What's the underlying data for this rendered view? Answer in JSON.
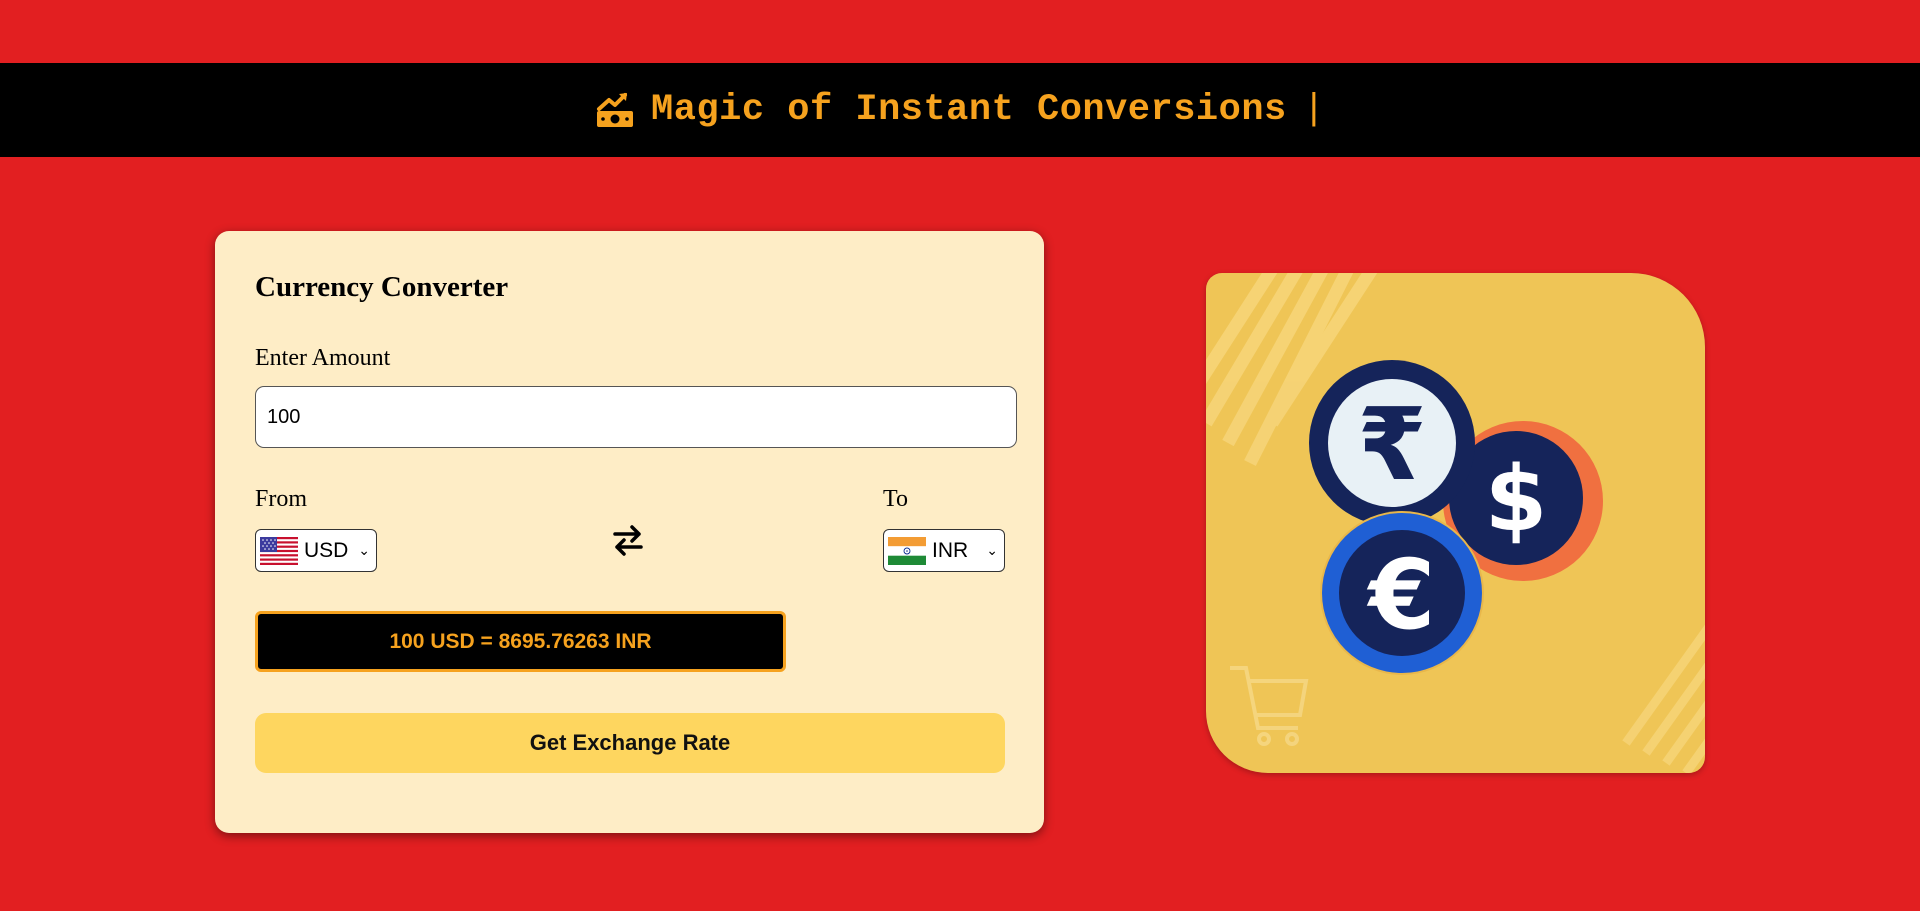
{
  "header": {
    "title": "Magic of Instant Conversions",
    "caret": "|",
    "icon": "money-chart-icon",
    "color": "#f6a21e"
  },
  "converter": {
    "title": "Currency Converter",
    "amount_label": "Enter Amount",
    "amount_value": "100",
    "from_label": "From",
    "to_label": "To",
    "from_currency": "USD",
    "to_currency": "INR",
    "swap_icon": "swap-arrows-icon",
    "result_text": "100 USD = 8695.76263 INR",
    "button_label": "Get Exchange Rate"
  },
  "illustration": {
    "symbols": [
      "₹",
      "$",
      "€"
    ]
  },
  "colors": {
    "background": "#e21f21",
    "banner": "#000000",
    "card": "#feedc6",
    "button": "#fed65f",
    "accent": "#f6a21e",
    "illustration_bg": "#efc556"
  }
}
